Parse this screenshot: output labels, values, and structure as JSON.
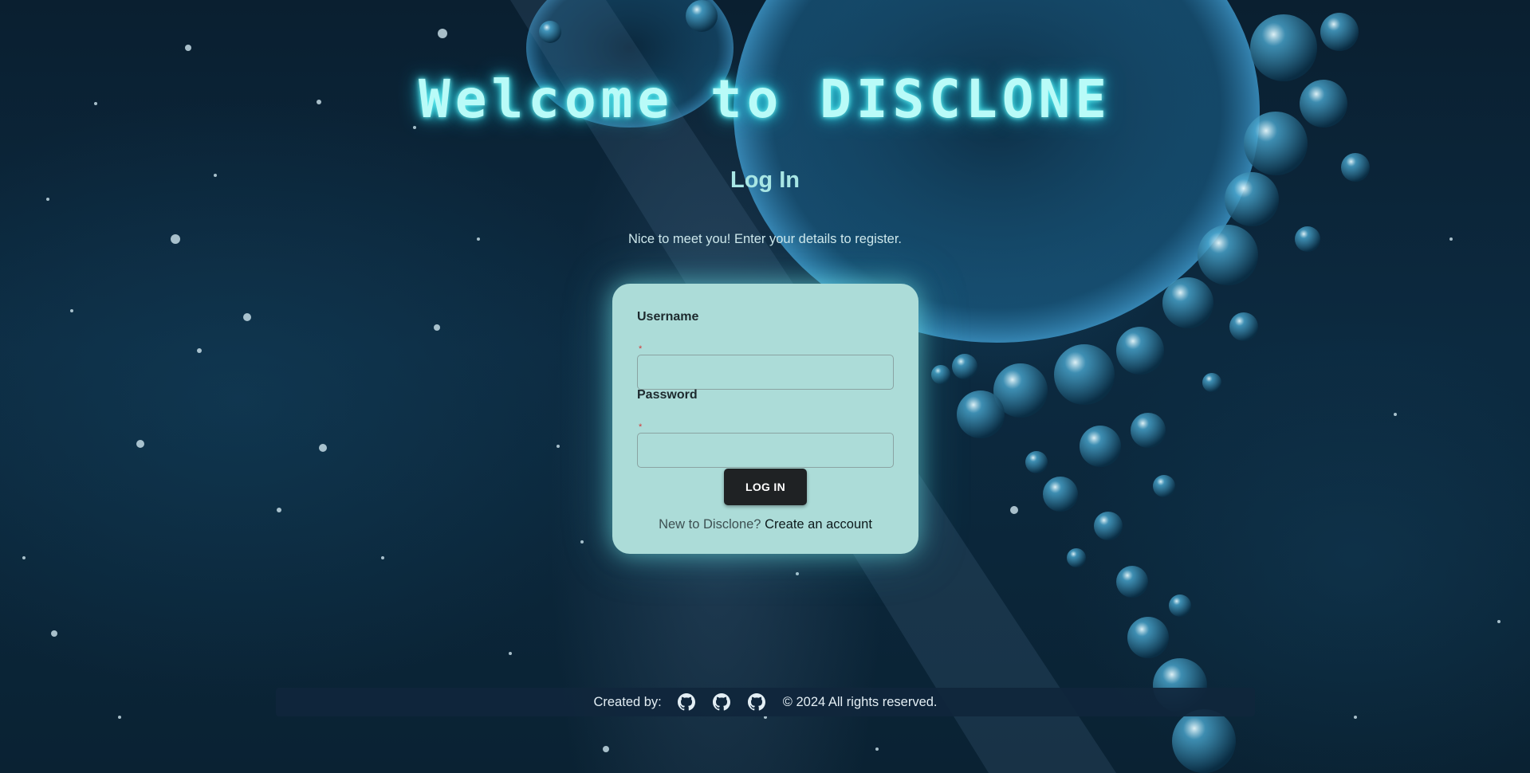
{
  "header": {
    "title": "Welcome to DISCLONE",
    "subtitle": "Log In",
    "intro": "Nice to meet you! Enter your details to register."
  },
  "form": {
    "username_label": "Username",
    "password_label": "Password",
    "required_marker": "*",
    "username_value": "",
    "password_value": "",
    "submit_label": "LOG IN",
    "signup_prompt": "New to Disclone?",
    "signup_link": "Create an account"
  },
  "footer": {
    "created_by": "Created by:",
    "author_links": [
      {
        "icon": "github-icon"
      },
      {
        "icon": "github-icon"
      },
      {
        "icon": "github-icon"
      }
    ],
    "copyright": "© 2024 All rights reserved."
  },
  "colors": {
    "title_glow": "#b9fbf8",
    "card_bg": "#acdcd8",
    "button_bg": "#1f2224",
    "footer_bg": "#10263c",
    "required": "#d23a3a"
  }
}
